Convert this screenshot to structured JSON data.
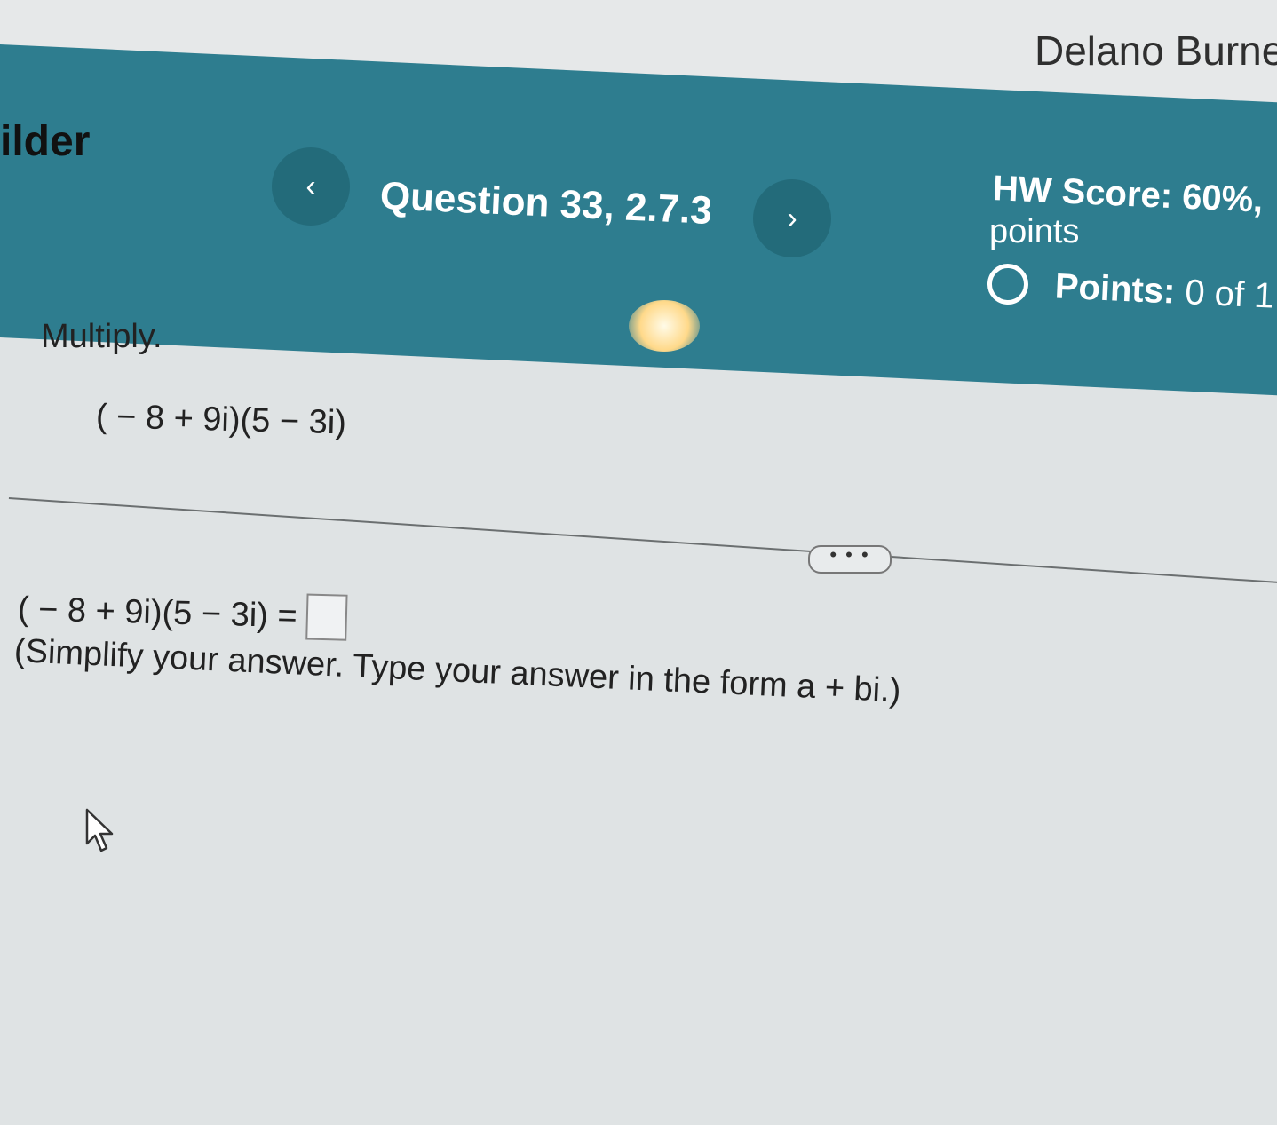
{
  "header": {
    "user_name": "Delano Burnet",
    "app_title_fragment": "ilder",
    "question_title": "Question 33, 2.7.3",
    "prev_glyph": "‹",
    "next_glyph": "›",
    "hw_score": "HW Score: 60%,",
    "hw_points_word": "points",
    "points_label": "Points:",
    "points_value": "0 of 1"
  },
  "question": {
    "instruction": "Multiply.",
    "expression": "( − 8 + 9i)(5 − 3i)",
    "more_button": "• • •",
    "answer_prompt": "( − 8 + 9i)(5 − 3i) =",
    "answer_value": "",
    "hint": "(Simplify your answer. Type your answer in the form a + bi.)"
  },
  "colors": {
    "header_bg": "#2e7d8f",
    "nav_button_bg": "#236b7a",
    "page_bg": "#dfe3e4"
  }
}
